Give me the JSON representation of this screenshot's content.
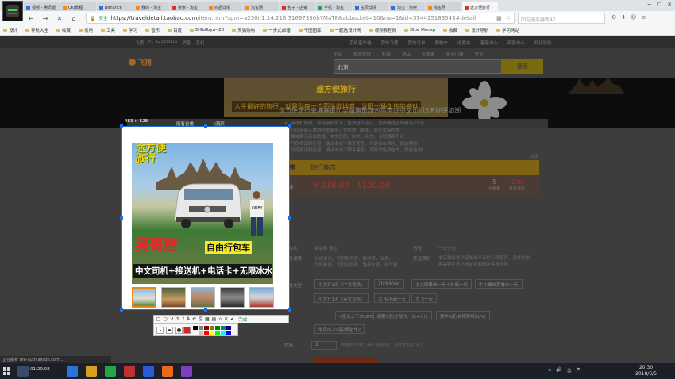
{
  "browser": {
    "tabs": [
      {
        "label": "视频 - 腾讯视",
        "color": "#2b73d6"
      },
      {
        "label": "CKI教程",
        "color": "#ff8a00"
      },
      {
        "label": "Behance",
        "color": "#2b73d6"
      },
      {
        "label": "我的 - 淘宝",
        "color": "#ff8a00"
      },
      {
        "label": "搜索 - 淘宝",
        "color": "#e02e24"
      },
      {
        "label": "商品详情",
        "color": "#ff8a00"
      },
      {
        "label": "淘宝网",
        "color": "#ff8a00"
      },
      {
        "label": "包子 - 店铺",
        "color": "#e02e24"
      },
      {
        "label": "手机 - 淘宝",
        "color": "#2aa44a"
      },
      {
        "label": "宝贝详情",
        "color": "#2b73d6"
      },
      {
        "label": "淘宝 - 热卖",
        "color": "#2b73d6"
      },
      {
        "label": "淘宝网",
        "color": "#ff8a00"
      },
      {
        "label": "途方便旅行",
        "color": "#e02e24"
      }
    ],
    "secure_label": "安全",
    "url_host": "https://traveldetail.taobao.com",
    "url_path": "/item.htm?spm=a230r.1.14.216.31697330hYMaT8&abbucket=10&ns=1&id=554415183543#detail",
    "search_placeholder": "回向服务器新47",
    "bookmarks": [
      "设计",
      "导航大全",
      "收藏",
      "常用",
      "工具",
      "学习",
      "音乐",
      "百度",
      "Billbilbya--28",
      "天猫购物",
      "一步式邮箱",
      "千图图库",
      "一起选设计网",
      "视频教程网",
      "Blue Monsp",
      "收藏",
      "设计导航",
      "学习网站"
    ]
  },
  "page": {
    "top_left": [
      "飞猪",
      "hi, a2328016",
      "消息",
      "手机"
    ],
    "top_right": [
      "手机客户端",
      "我的飞猪",
      "我的订单",
      "购物车",
      "收藏夹",
      "客服中心",
      "商家中心",
      "网站导航"
    ],
    "logo": "飞猪",
    "search_tabs": [
      "全部",
      "旅游度假",
      "机票",
      "酒店",
      "火车票",
      "景点门票",
      "签证"
    ],
    "search_value": "北京",
    "search_button": "搜索",
    "banner_title": "途方便旅行",
    "banner_slogan": "人生最好的旅行，就是你在一个陌生的地方，发现一种久违的感动",
    "breadcrumb": [
      "所有分类",
      "首页"
    ],
    "product_title": "途方便旅行柬埔寨暹粒吴哥窟旅游包车李好中文司机3天好评如潮",
    "bullets": [
      "接送机免费，免费接机水水，免费送回酒店，免费赠送当地电话卡1张",
      "可以带家人旅游包车服务，凭优惠门票单，原价去接包车",
      "柬埔寨元素自助游，中文司机，中文、英文，当地通都可以",
      "可免费定制行程，请点击向下联系客服，可更改车费用，提前预约！",
      "可免费定制行程，请点击向下联系客服，可更改免费包车，提前咨询！"
    ],
    "report": "举报",
    "promo_brand": "飞猪",
    "promo_text": "旅行集市",
    "price_label": "价格",
    "price": "¥ 218.00 - 1100.00",
    "stat1_value": "5",
    "stat1_label": "月销量",
    "stat2_value": "130",
    "stat2_label": "累计评价",
    "dest_label": "目的地",
    "dest_value": "柬埔寨 暹粒",
    "trip_label": "行程",
    "trip_value": "一价全包",
    "service_label": "服务保障",
    "service_values": [
      "车辆费用，司机服务费，路桥费，油费，",
      "司机餐费，司机住宿费，路停车费，停车费",
      "凭证须知",
      "本店铺仅提供该旅游产品的行程服务，具体的游客需要在线下预定或面联系客服安排"
    ],
    "options_label": "套餐类型",
    "options": [
      "小大开1天（中文司机）",
      "2hr&4/car",
      "小大摩棒单一天＋外面一天",
      "中小螺丝套餐余一天",
      "小大开1天（英文司机）",
      "大飞/小画一天",
      "大飞一天",
      "4座以上下(TUKTUK车)",
      "越野5座(小轿车（1-4人）)",
      "豪华5座(兰博萨特SUV)",
      "牛巴(6-15座(面包车))"
    ],
    "qty_label": "数量",
    "qty_value": "1",
    "qty_note": "库存5323件（每人限购5件，此时可购买1件）"
  },
  "snip": {
    "dimensions": "483 × 528",
    "photo_title": "途方便\n旅行",
    "photo_name": "吴哥窟",
    "photo_tag": "自由行包车",
    "photo_caption": "中文司机+接送机+电话卡+无限冰水",
    "shirt_text": "OBEY",
    "done_label": "完成",
    "tools": [
      "□",
      "○",
      "↗",
      "✎",
      "∕",
      "A",
      "↶",
      "⎘",
      "▦",
      "▤",
      "⌂",
      "✕",
      "✔"
    ],
    "current_color": "#e02020",
    "palette": [
      "#000000",
      "#808080",
      "#800000",
      "#808000",
      "#008000",
      "#008080",
      "#000080",
      "#ffffff",
      "#c0c0c0",
      "#ff0000",
      "#ffff00",
      "#00ff00",
      "#00ffff",
      "#0000ff"
    ]
  },
  "statusbar": "正在解析 tim-auth.alicdn.com...",
  "taskbar": {
    "task_text": "01:20:08",
    "tray": [
      "∧",
      "🔊",
      "英",
      "⚑"
    ],
    "time": "20:30",
    "date": "2018/6/5"
  }
}
